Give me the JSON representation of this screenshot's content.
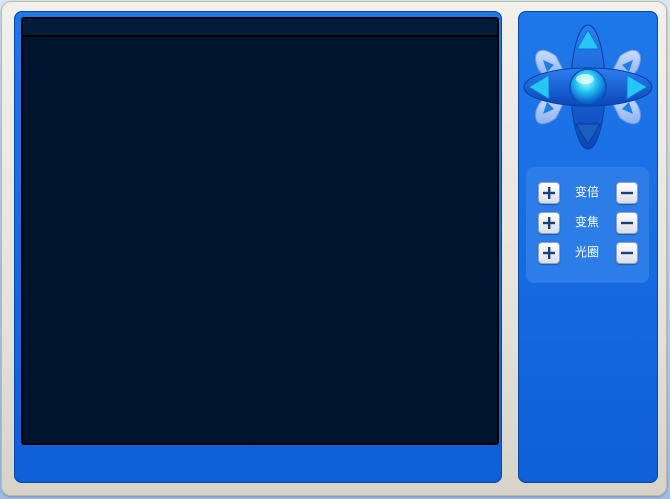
{
  "colors": {
    "panel_blue": "#1a6fe4",
    "video_bg": "#00142e",
    "frame_beige": "#ece9e1"
  },
  "ptz": {
    "icons": [
      "arrow-up-icon",
      "arrow-down-icon",
      "arrow-left-icon",
      "arrow-right-icon",
      "arrow-upleft-icon",
      "arrow-upright-icon",
      "arrow-downleft-icon",
      "arrow-downright-icon",
      "center-button-icon"
    ]
  },
  "lens": {
    "zoom_label": "变倍",
    "focus_label": "变焦",
    "iris_label": "光圈"
  }
}
